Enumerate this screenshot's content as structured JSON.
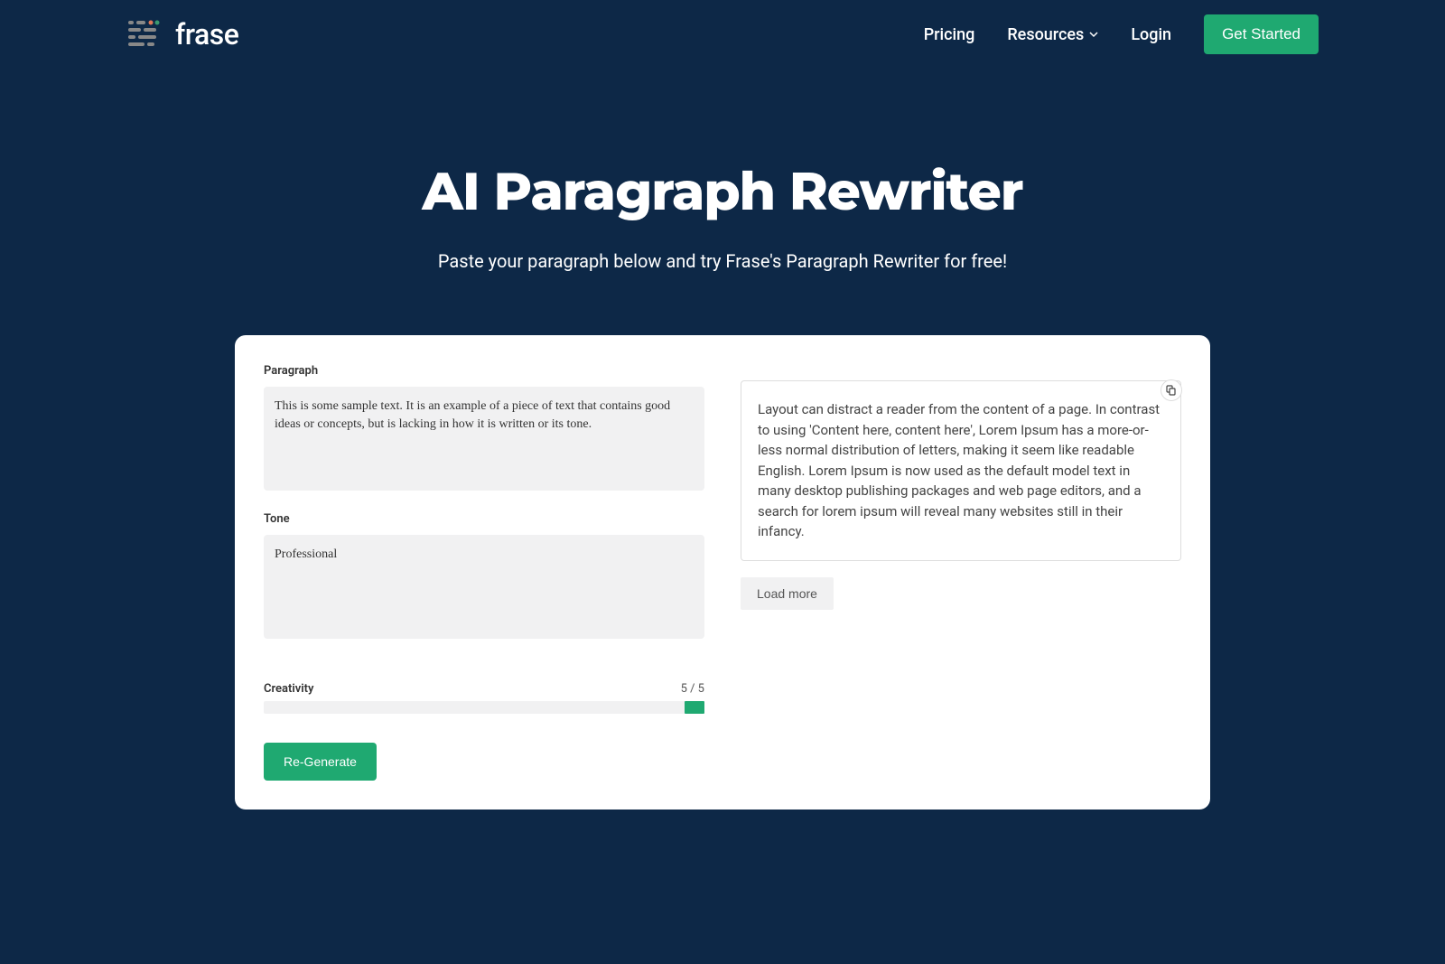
{
  "header": {
    "logo_text": "frase",
    "nav": {
      "pricing": "Pricing",
      "resources": "Resources",
      "login": "Login",
      "get_started": "Get Started"
    }
  },
  "hero": {
    "title": "AI Paragraph Rewriter",
    "subtitle": "Paste your paragraph below and try Frase's Paragraph Rewriter for free!"
  },
  "tool": {
    "paragraph_label": "Paragraph",
    "paragraph_value": "This is some sample text. It is an example of a piece of text that contains good ideas or concepts, but is lacking in how it is written or its tone.",
    "tone_label": "Tone",
    "tone_value": "Professional",
    "creativity_label": "Creativity",
    "creativity_value": "5 / 5",
    "regenerate_label": "Re-Generate",
    "output_text": "Layout can distract a reader from the content of a page. In contrast to using 'Content here, content here', Lorem Ipsum has a more-or-less normal distribution of letters, making it seem like readable English. Lorem Ipsum is now used as the default model text in many desktop publishing packages and web page editors, and a search for lorem ipsum will reveal many websites still in their infancy.",
    "load_more_label": "Load more"
  }
}
